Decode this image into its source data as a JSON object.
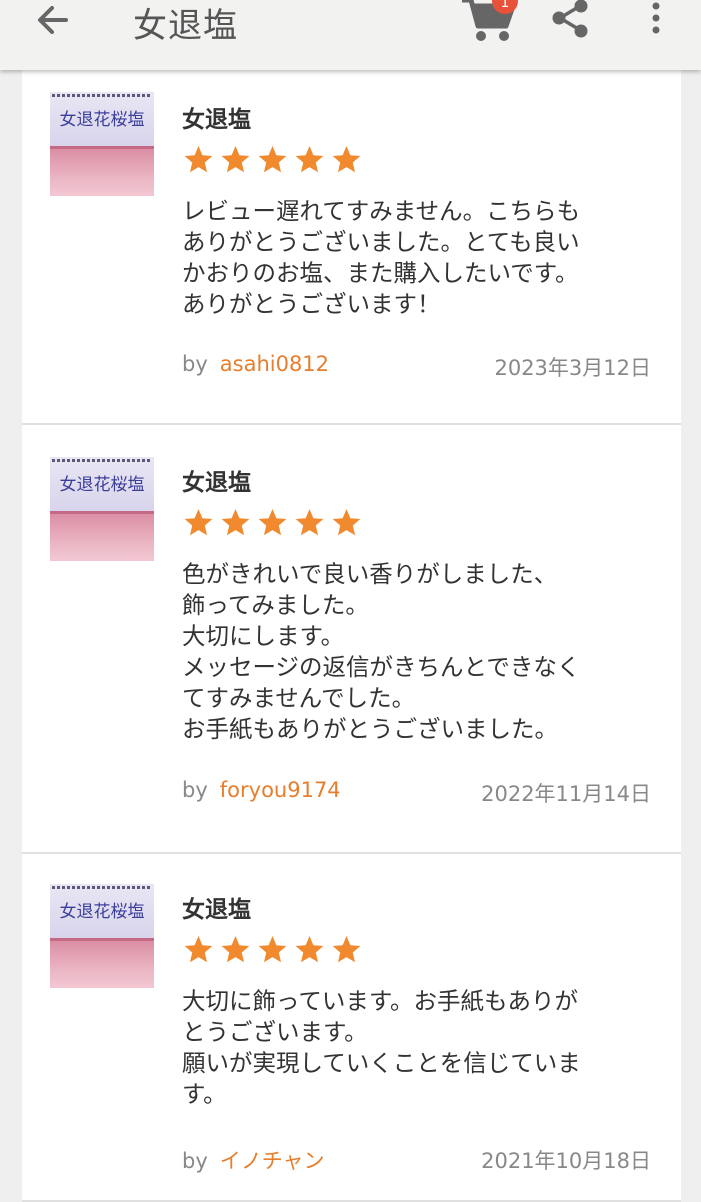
{
  "appbar": {
    "title": "女退塩",
    "cart_badge": "1",
    "icons": [
      "back-arrow-icon",
      "cart-icon",
      "share-icon",
      "more-vert-icon"
    ]
  },
  "colors": {
    "star": "#f18a2e",
    "username": "#e67e2d",
    "badge": "#e8523a"
  },
  "reviews": [
    {
      "thumb_label": "女退花桜塩",
      "title": "女退塩",
      "rating": 5,
      "body": [
        "レビュー遅れてすみません。こちらも",
        "ありがとうございました。とても良い",
        "かおりのお塩、また購入したいです。",
        "ありがとうございます！"
      ],
      "by": "by",
      "user": "asahi0812",
      "date": "2023年3月12日"
    },
    {
      "thumb_label": "女退花桜塩",
      "title": "女退塩",
      "rating": 5,
      "body": [
        "色がきれいで良い香りがしました、",
        "飾ってみました。",
        "大切にします。",
        "メッセージの返信がきちんとできなく",
        "てすみませんでした。",
        "お手紙もありがとうございました。"
      ],
      "by": "by",
      "user": "foryou9174",
      "date": "2022年11月14日"
    },
    {
      "thumb_label": "女退花桜塩",
      "title": "女退塩",
      "rating": 5,
      "body": [
        "大切に飾っています。お手紙もありが",
        "とうございます。",
        "願いが実現していくことを信じていま",
        "す。"
      ],
      "by": "by",
      "user": "イノチャン",
      "date": "2021年10月18日"
    }
  ]
}
